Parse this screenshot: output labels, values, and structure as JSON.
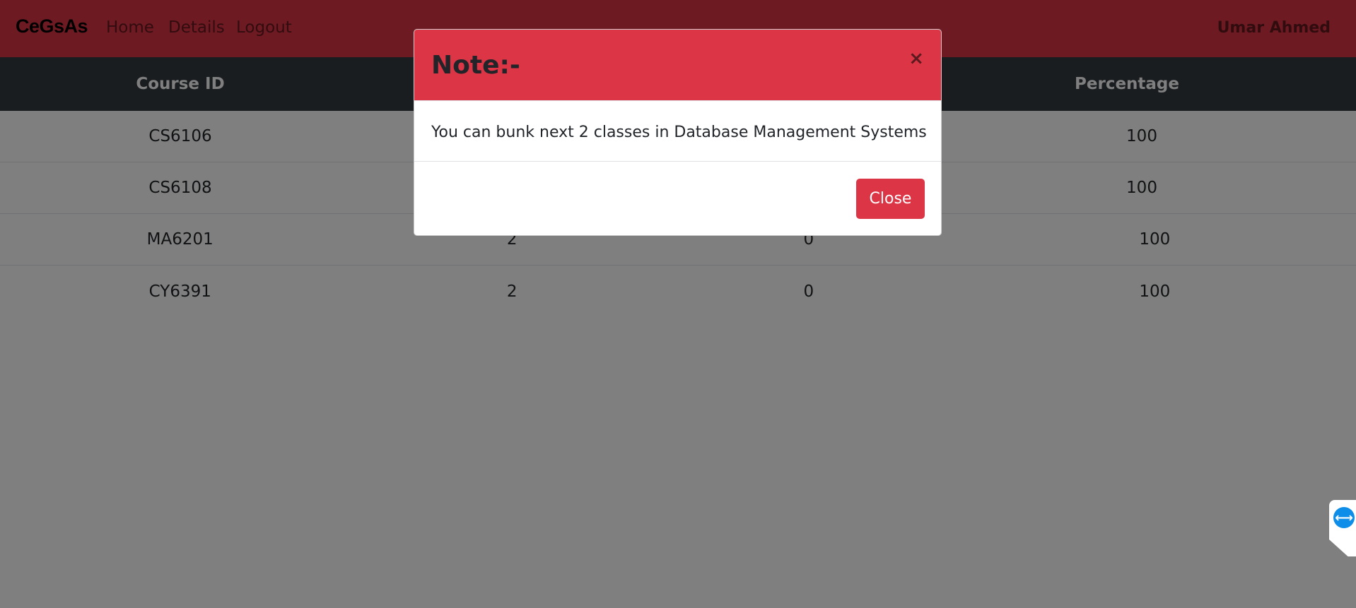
{
  "navbar": {
    "brand": "CeGsAs",
    "links": [
      "Home",
      "Details",
      "Logout"
    ],
    "user": "Umar Ahmed"
  },
  "table": {
    "headers": [
      "Course ID",
      "Percentage"
    ],
    "rows": [
      {
        "course_id": "CS6106",
        "col2": "",
        "col3": "",
        "percentage": "100"
      },
      {
        "course_id": "CS6108",
        "col2": "",
        "col3": "",
        "percentage": "100"
      },
      {
        "course_id": "MA6201",
        "col2": "2",
        "col3": "0",
        "percentage": "100"
      },
      {
        "course_id": "CY6391",
        "col2": "2",
        "col3": "0",
        "percentage": "100"
      }
    ]
  },
  "modal": {
    "title": "Note:-",
    "close_x": "×",
    "message": "You can bunk next 2 classes in Database Management Systems",
    "close_button": "Close"
  },
  "widget": {
    "icon": "teamviewer-icon",
    "glyph": "⟷"
  },
  "colors": {
    "primary": "#dc3545",
    "dark": "#343a40",
    "backdrop": "rgba(0,0,0,0.5)"
  }
}
